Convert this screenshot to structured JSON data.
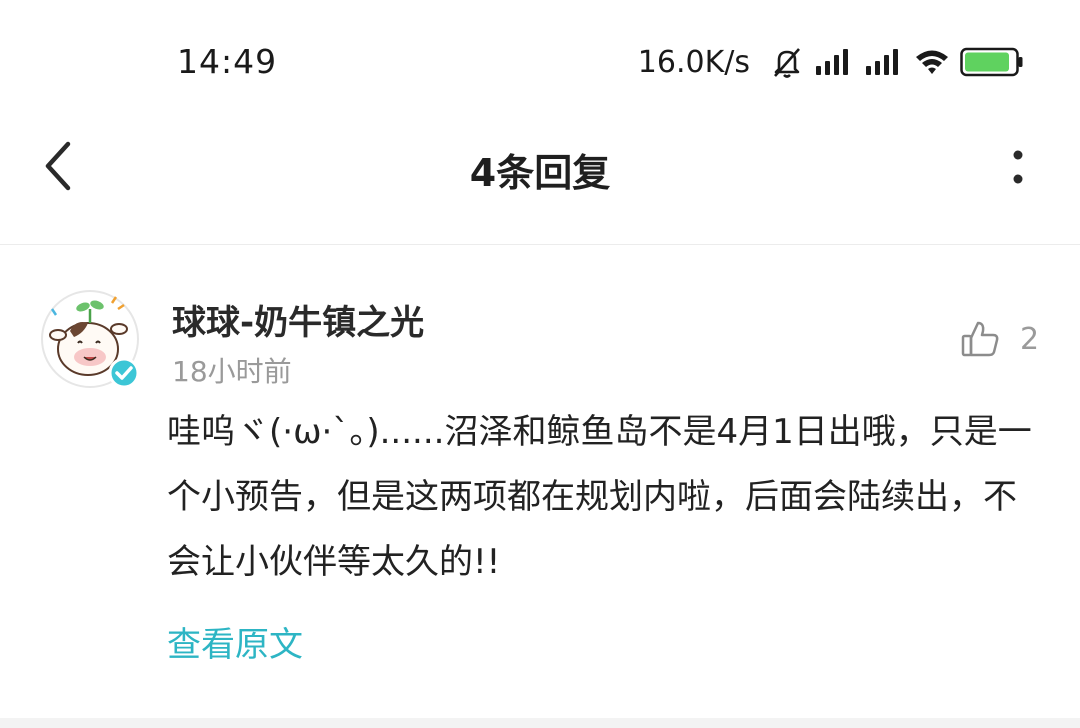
{
  "status_bar": {
    "time": "14:49",
    "net_speed": "16.0K/s",
    "icons": [
      "bell-muted-icon",
      "signal-icon",
      "signal-icon",
      "wifi-icon",
      "battery-icon"
    ],
    "battery_color": "#5fd25f"
  },
  "nav": {
    "title": "4条回复",
    "back_icon": "chevron-left-icon",
    "more_icon": "more-vertical-icon"
  },
  "comment": {
    "username": "球球-奶牛镇之光",
    "time_ago": "18小时前",
    "likes": "2",
    "text": "哇呜ヾ(·ω·`。)......沼泽和鲸鱼岛不是4月1日出哦，只是一个小预告，但是这两项都在规划内啦，后面会陆续出，不会让小伙伴等太久的!!",
    "view_original": "查看原文",
    "verified_color": "#3cc6d6",
    "link_color": "#2db5c4"
  }
}
